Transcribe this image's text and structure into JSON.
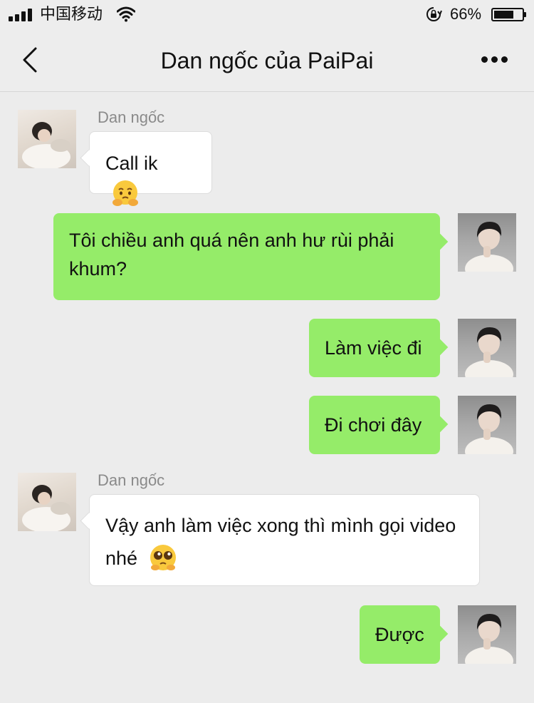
{
  "status_bar": {
    "carrier": "中国移动",
    "battery_percent": "66%",
    "battery_level": 0.66,
    "icons": [
      "signal-icon",
      "wifi-icon",
      "orientation-lock-icon",
      "battery-icon"
    ]
  },
  "header": {
    "title": "Dan ngốc của PaiPai",
    "icons": [
      "back-icon",
      "more-icon"
    ]
  },
  "colors": {
    "background": "#ececec",
    "outgoing_bubble": "#95ec69",
    "incoming_bubble": "#ffffff",
    "sender_name": "#8a8a8a"
  },
  "messages": [
    {
      "direction": "incoming",
      "sender": "Dan ngốc",
      "text": "Call ik",
      "emoji": "pleading-face-with-hands"
    },
    {
      "direction": "outgoing",
      "text": "Tôi chiều anh quá nên anh hư rùi phải khum?"
    },
    {
      "direction": "outgoing",
      "text": "Làm việc đi"
    },
    {
      "direction": "outgoing",
      "text": "Đi chơi đây"
    },
    {
      "direction": "incoming",
      "sender": "Dan ngốc",
      "text": "Vậy anh làm việc xong thì mình gọi video nhé",
      "emoji": "pleading-face"
    },
    {
      "direction": "outgoing",
      "text": "Được"
    }
  ]
}
